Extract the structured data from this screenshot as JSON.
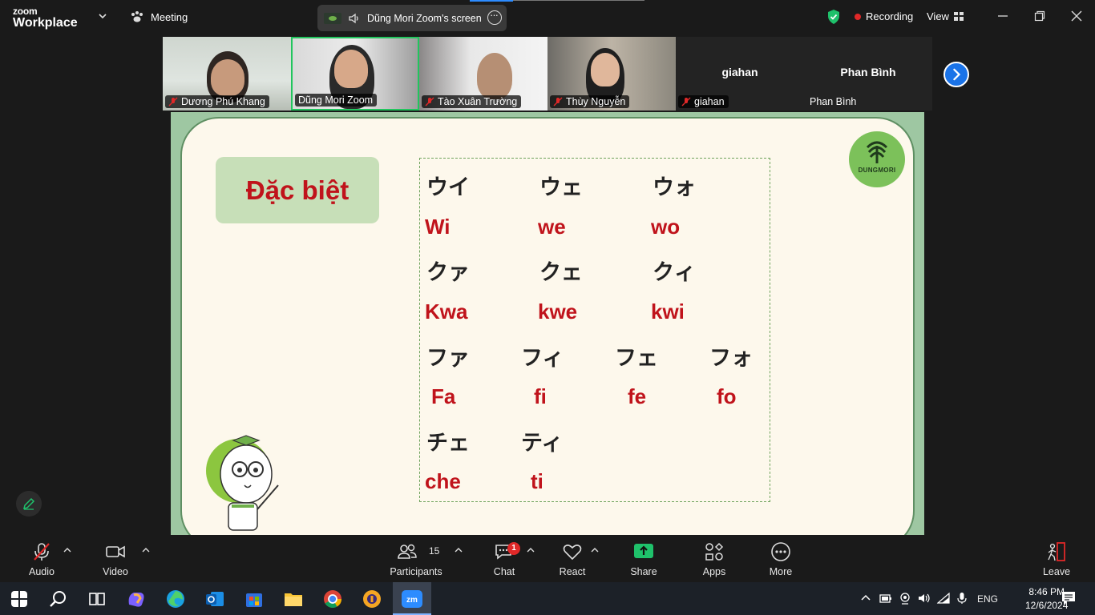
{
  "topbar": {
    "brand_line1": "zoom",
    "brand_line2": "Workplace",
    "meeting_label": "Meeting",
    "share_label": "Dũng Mori Zoom's screen",
    "recording_label": "Recording",
    "view_label": "View"
  },
  "participants_strip": [
    {
      "name": "Dương Phú Khang",
      "muted": true
    },
    {
      "name": "Dũng Mori Zoom",
      "muted": false,
      "active": true
    },
    {
      "name": "Tào Xuân Trường",
      "muted": true
    },
    {
      "name": "Thùy Nguyễn",
      "muted": true
    },
    {
      "name": "giahan",
      "muted": true,
      "video": false,
      "center_label": "giahan"
    },
    {
      "name": "Phan Bình",
      "muted": false,
      "video": false,
      "center_label": "Phan Bình"
    }
  ],
  "slide": {
    "title": "Đặc biệt",
    "logo_text": "DUNGMORI",
    "rows": [
      {
        "kana": [
          "ウイ",
          "ウェ",
          "ウォ"
        ],
        "roma": [
          "Wi",
          "we",
          "wo"
        ]
      },
      {
        "kana": [
          "クァ",
          "クェ",
          "クィ"
        ],
        "roma": [
          "Kwa",
          "kwe",
          "kwi"
        ]
      },
      {
        "kana": [
          "ファ",
          "フィ",
          "フェ",
          "フォ"
        ],
        "roma": [
          "Fa",
          "fi",
          "fe",
          "fo"
        ]
      },
      {
        "kana": [
          "チェ",
          "ティ"
        ],
        "roma": [
          "che",
          "ti"
        ]
      }
    ]
  },
  "toolbar": {
    "audio": "Audio",
    "video": "Video",
    "participants": "Participants",
    "participants_count": "15",
    "chat": "Chat",
    "chat_badge": "1",
    "react": "React",
    "share": "Share",
    "apps": "Apps",
    "more": "More",
    "leave": "Leave"
  },
  "taskbar": {
    "language": "ENG",
    "time": "8:46 PM",
    "date": "12/6/2024"
  },
  "colors": {
    "accent_green": "#22c55e",
    "share_green": "#1fc16b",
    "slide_red": "#c0131b",
    "zoom_blue": "#1a73e8"
  }
}
